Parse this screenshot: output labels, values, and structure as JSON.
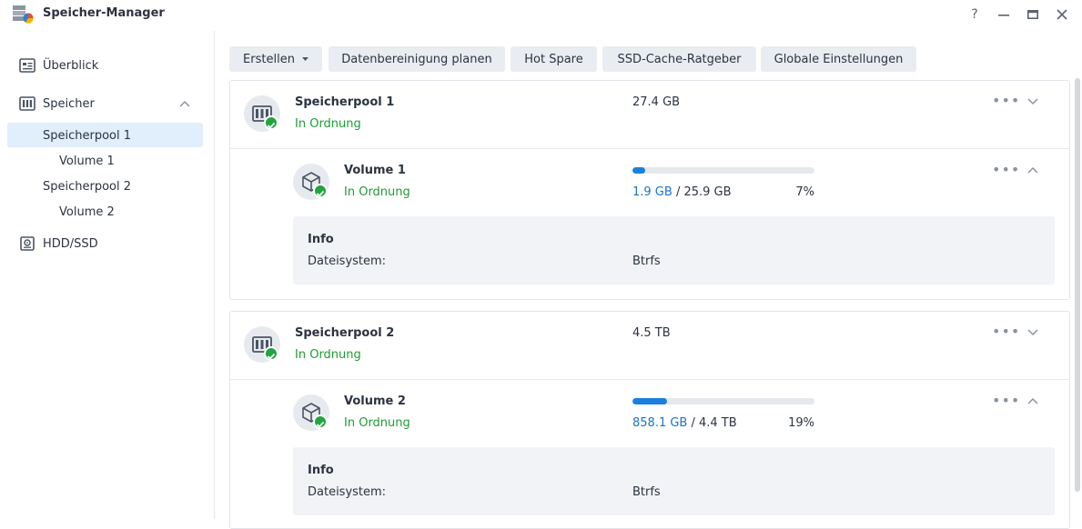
{
  "window": {
    "title": "Speicher-Manager",
    "help_label": "?",
    "minimize_label": "—",
    "maximize_label": "▭",
    "close_label": "✕"
  },
  "sidebar": {
    "overview": "Überblick",
    "storage": "Speicher",
    "pool1": "Speicherpool 1",
    "volume1": "Volume 1",
    "pool2": "Speicherpool 2",
    "volume2": "Volume 2",
    "hdd": "HDD/SSD"
  },
  "toolbar": {
    "create": "Erstellen",
    "scrub": "Datenbereinigung planen",
    "hotspare": "Hot Spare",
    "ssd": "SSD-Cache-Ratgeber",
    "global": "Globale Einstellungen"
  },
  "pools": [
    {
      "name": "Speicherpool 1",
      "status": "In Ordnung",
      "size": "27.4 GB",
      "volume": {
        "name": "Volume 1",
        "status": "In Ordnung",
        "used": "1.9 GB",
        "sep": " / ",
        "total": "25.9 GB",
        "percent_label": "7%",
        "usage_fraction": 0.07,
        "info_title": "Info",
        "fs_key": "Dateisystem:",
        "fs_val": "Btrfs"
      }
    },
    {
      "name": "Speicherpool 2",
      "status": "In Ordnung",
      "size": "4.5 TB",
      "volume": {
        "name": "Volume 2",
        "status": "In Ordnung",
        "used": "858.1 GB",
        "sep": " / ",
        "total": "4.4 TB",
        "percent_label": "19%",
        "usage_fraction": 0.19,
        "info_title": "Info",
        "fs_key": "Dateisystem:",
        "fs_val": "Btrfs"
      }
    }
  ],
  "colors": {
    "accent": "#1a7fde",
    "ok": "#23a342",
    "active_bg": "#e1eefb"
  },
  "icons": [
    "storage-manager-icon",
    "overview-icon",
    "storage-icon",
    "hdd-icon",
    "pool-icon",
    "volume-icon",
    "check-icon",
    "more-icon",
    "chevron-down-icon",
    "chevron-up-icon",
    "caret-down-icon"
  ]
}
